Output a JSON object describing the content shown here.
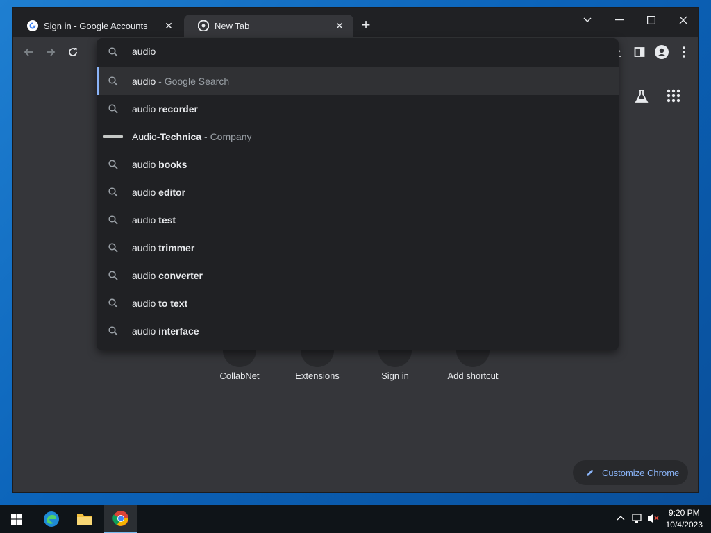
{
  "browser": {
    "tabs": [
      {
        "title": "Sign in - Google Accounts",
        "active": false,
        "favicon": "google-g-icon"
      },
      {
        "title": "New Tab",
        "active": true,
        "favicon": "chrome-icon"
      }
    ],
    "omnibox": {
      "text": "audio ",
      "suggestions": [
        {
          "icon": "search-icon",
          "prefix": "audio",
          "bold": "",
          "desc": " - Google Search",
          "selected": true
        },
        {
          "icon": "search-icon",
          "prefix": "audio ",
          "bold": "recorder",
          "desc": ""
        },
        {
          "icon": "brand-logo-icon",
          "prefix": "Audio-",
          "bold": "Technica",
          "desc": " - Company"
        },
        {
          "icon": "search-icon",
          "prefix": "audio ",
          "bold": "books",
          "desc": ""
        },
        {
          "icon": "search-icon",
          "prefix": "audio ",
          "bold": "editor",
          "desc": ""
        },
        {
          "icon": "search-icon",
          "prefix": "audio ",
          "bold": "test",
          "desc": ""
        },
        {
          "icon": "search-icon",
          "prefix": "audio ",
          "bold": "trimmer",
          "desc": ""
        },
        {
          "icon": "search-icon",
          "prefix": "audio ",
          "bold": "converter",
          "desc": ""
        },
        {
          "icon": "search-icon",
          "prefix": "audio ",
          "bold": "to text",
          "desc": ""
        },
        {
          "icon": "search-icon",
          "prefix": "audio ",
          "bold": "interface",
          "desc": ""
        }
      ]
    },
    "ntp": {
      "shortcuts": [
        {
          "label": "CollabNet"
        },
        {
          "label": "Extensions"
        },
        {
          "label": "Sign in"
        },
        {
          "label": "Add shortcut"
        }
      ],
      "customize_label": "Customize Chrome"
    }
  },
  "taskbar": {
    "time": "9:20 PM",
    "date": "10/4/2023"
  },
  "colors": {
    "accent": "#8ab4f8",
    "frame": "#202124",
    "toolbar": "#35363a"
  }
}
